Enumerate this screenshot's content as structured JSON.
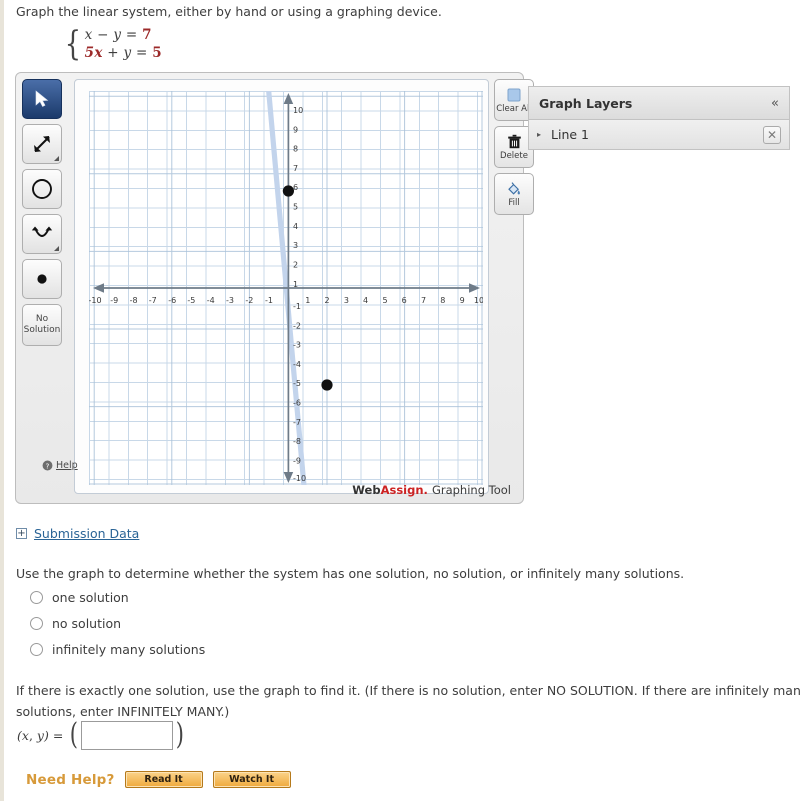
{
  "prompt": "Graph the linear system, either by hand or using a graphing device.",
  "system": {
    "eq1": {
      "lhs_x": "x",
      "op": "−",
      "lhs_y": "y",
      "eq": "=",
      "rhs": "7"
    },
    "eq2": {
      "lhs_x": "5x",
      "op": "+",
      "lhs_y": "y",
      "eq": "=",
      "rhs": "5"
    }
  },
  "graph_tool": {
    "tools": [
      {
        "name": "select-tool",
        "icon": "arrow-cursor-icon",
        "active": true
      },
      {
        "name": "line-tool",
        "icon": "double-arrow-line-icon",
        "active": false
      },
      {
        "name": "circle-tool",
        "icon": "circle-icon",
        "active": false
      },
      {
        "name": "parabola-tool",
        "icon": "parabola-icon",
        "active": false
      },
      {
        "name": "point-tool",
        "icon": "filled-dot-icon",
        "active": false
      },
      {
        "name": "no-solution-tool",
        "icon": "no-solution-icon",
        "label": "No Solution",
        "active": false
      }
    ],
    "side_buttons": [
      {
        "name": "clear-all-button",
        "label": "Clear All",
        "icon": "blue-square-icon"
      },
      {
        "name": "delete-button",
        "label": "Delete",
        "icon": "trash-icon"
      },
      {
        "name": "fill-button",
        "label": "Fill",
        "icon": "paint-bucket-icon"
      }
    ],
    "help_label": "Help",
    "brand": {
      "part1": "Web",
      "part2": "Assign.",
      "part3": "Graphing Tool"
    }
  },
  "graph_layers": {
    "title": "Graph Layers",
    "collapse_icon": "«",
    "rows": [
      {
        "expander": "▸",
        "label": "Line 1",
        "delete_icon": "✕"
      }
    ]
  },
  "chart_data": {
    "type": "line",
    "title": "",
    "xlabel": "",
    "ylabel": "",
    "xlim": [
      -10.6,
      10.6
    ],
    "ylim": [
      -10.6,
      10.6
    ],
    "xticks": [
      -10,
      -9,
      -8,
      -7,
      -6,
      -5,
      -4,
      -3,
      -2,
      -1,
      1,
      2,
      3,
      4,
      5,
      6,
      7,
      8,
      9,
      10
    ],
    "yticks": [
      10,
      9,
      8,
      7,
      6,
      5,
      4,
      3,
      2,
      1,
      -1,
      -2,
      -3,
      -4,
      -5,
      -6,
      -7,
      -8,
      -9,
      -10
    ],
    "grid": true,
    "legend": "none",
    "series": [
      {
        "name": "Line 1",
        "equation": "5x + y = 5",
        "color": "#c3d4ec",
        "slope": -5,
        "intercept": 5,
        "points": [
          {
            "x": 0,
            "y": 5
          },
          {
            "x": 2,
            "y": -5
          }
        ]
      }
    ]
  },
  "submission": {
    "expand_icon": "+",
    "label": "Submission Data"
  },
  "question_choice": {
    "text": "Use the graph to determine whether the system has one solution, no solution, or infinitely many solutions.",
    "options": [
      {
        "label": "one solution",
        "selected": false
      },
      {
        "label": "no solution",
        "selected": false
      },
      {
        "label": "infinitely many solutions",
        "selected": false
      }
    ]
  },
  "question_point": {
    "text": "If there is exactly one solution, use the graph to find it. (If there is no solution, enter NO SOLUTION. If there are infinitely many solutions, enter INFINITELY MANY.)",
    "label_x": "x",
    "label_comma": ", ",
    "label_y": "y",
    "label_eq": " = ",
    "open_paren": "(",
    "close_paren": ")",
    "input_value": "",
    "input_placeholder": ""
  },
  "need_help": {
    "label": "Need Help?",
    "buttons": [
      {
        "label": "Read It"
      },
      {
        "label": "Watch It"
      }
    ]
  }
}
